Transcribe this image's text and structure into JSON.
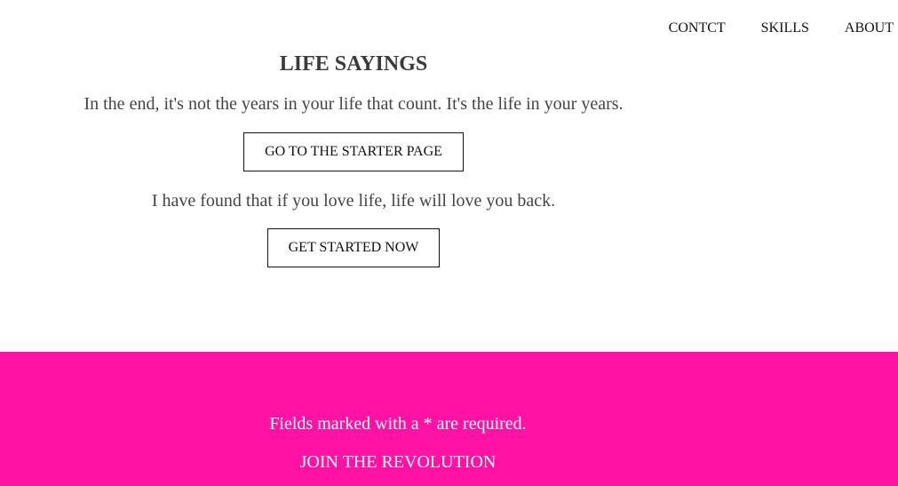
{
  "nav": {
    "items": [
      {
        "label": "CONTCT"
      },
      {
        "label": "SKILLS"
      },
      {
        "label": "ABOUT"
      }
    ]
  },
  "main": {
    "title": "LIFE SAYINGS",
    "quote1": "In the end, it's not the years in your life that count. It's the life in your years.",
    "button1": "GO TO THE STARTER PAGE",
    "quote2": "I have found that if you love life, life will love you back.",
    "button2": "GET STARTED NOW"
  },
  "footer": {
    "note": "Fields marked with a * are required.",
    "join_label": "JOIN THE REVOLUTION"
  },
  "colors": {
    "footer_bg": "#ff12a4",
    "text": "#444444"
  }
}
